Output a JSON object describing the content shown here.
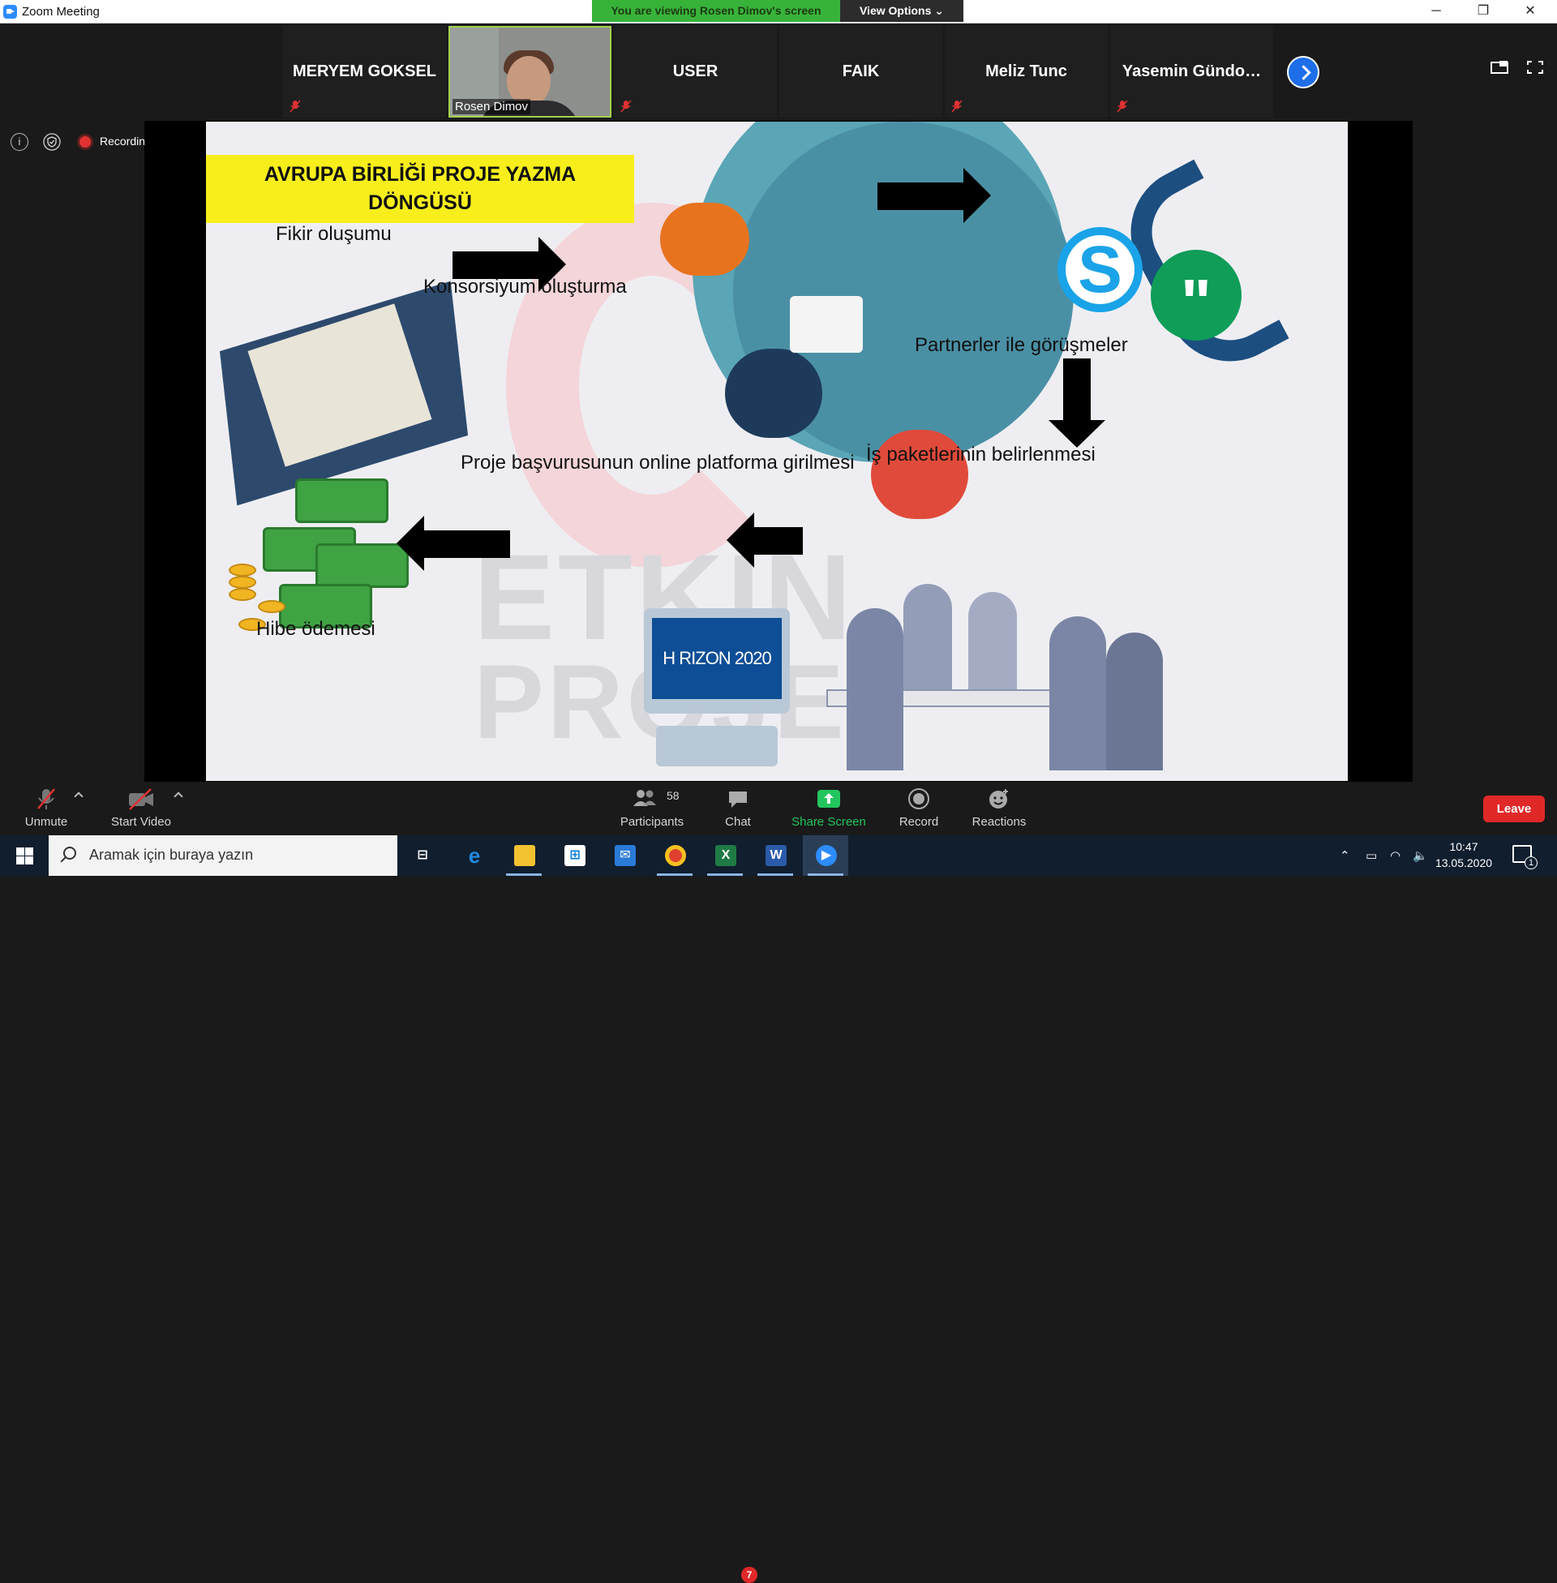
{
  "window": {
    "title": "Zoom Meeting",
    "viewing_banner": "You are viewing Rosen Dimov's screen",
    "view_options": "View Options",
    "controls": [
      "─",
      "❐",
      "✕"
    ]
  },
  "participants": [
    {
      "name": "MERYEM GOKSEL",
      "muted": true
    },
    {
      "name": "Rosen Dimov",
      "video": true,
      "muted": true
    },
    {
      "name": "USER",
      "muted": false
    },
    {
      "name": "FAIK",
      "muted": false
    },
    {
      "name": "Meliz Tunc",
      "muted": true
    },
    {
      "name": "Yasemin  Gündo…",
      "muted": true
    }
  ],
  "meeting_status": {
    "recording_label": "Recording"
  },
  "slide": {
    "title_line1": "AVRUPA BİRLİĞİ PROJE YAZMA",
    "title_line2": "DÖNGÜSÜ",
    "steps": [
      "Fikir oluşumu",
      "Konsorsiyum oluşturma",
      "Partnerler ile görüşmeler",
      "İş paketlerinin belirlenmesi",
      "Proje başvurusunun online platforma girilmesi",
      "Hibe ödemesi"
    ],
    "horizon_text": "H RIZON 2020",
    "watermark_1": "ETKIN",
    "watermark_2": "PROJE"
  },
  "toolbar": {
    "unmute": "Unmute",
    "start_video": "Start Video",
    "participants": "Participants",
    "participants_count": "58",
    "chat": "Chat",
    "chat_badge": "7",
    "share_screen": "Share Screen",
    "record": "Record",
    "reactions": "Reactions",
    "leave": "Leave"
  },
  "taskbar": {
    "search_placeholder": "Aramak için buraya yazın",
    "time": "10:47",
    "date": "13.05.2020",
    "notification_count": "1"
  },
  "colors": {
    "zoom_blue": "#2d8cff",
    "viewing_green": "#38b33a",
    "leave_red": "#e02828",
    "banner_yellow": "#f7ee1c",
    "share_green": "#22c55e"
  }
}
